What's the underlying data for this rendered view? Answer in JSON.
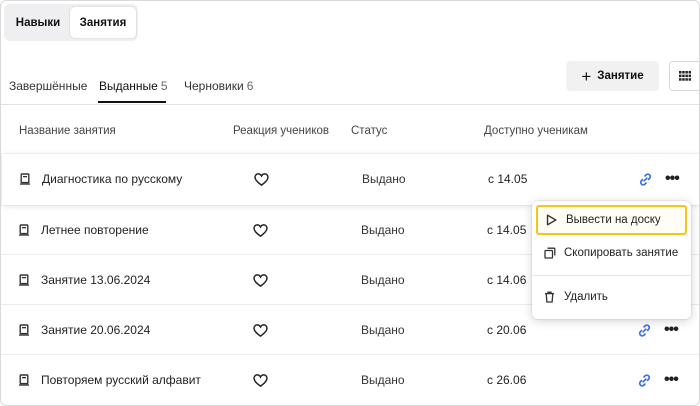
{
  "top_switch": {
    "items": [
      "Навыки",
      "Занятия"
    ],
    "active": "Занятия"
  },
  "tabs": [
    {
      "label": "Завершённые",
      "count": ""
    },
    {
      "label": "Выданные",
      "count": "5"
    },
    {
      "label": "Черновики",
      "count": "6"
    }
  ],
  "actions": {
    "add_label": "Занятие",
    "add_icon": "plus-icon",
    "view_icon": "grid-view-icon"
  },
  "table": {
    "headers": {
      "name": "Название занятия",
      "reaction": "Реакция учеников",
      "status": "Статус",
      "available": "Доступно ученикам"
    },
    "rows": [
      {
        "name": "Диагностика по русскому",
        "status": "Выдано",
        "date": "с 14.05"
      },
      {
        "name": "Летнее повторение",
        "status": "Выдано",
        "date": "с 14.05"
      },
      {
        "name": "Занятие 13.06.2024",
        "status": "Выдано",
        "date": "с 14.06"
      },
      {
        "name": "Занятие 20.06.2024",
        "status": "Выдано",
        "date": "с 20.06"
      },
      {
        "name": "Повторяем русский алфавит",
        "status": "Выдано",
        "date": "с 26.06"
      }
    ]
  },
  "context_menu": {
    "items": [
      {
        "label": "Вывести на доску",
        "icon": "play-icon"
      },
      {
        "label": "Скопировать занятие",
        "icon": "copy-icon"
      },
      {
        "label": "Удалить",
        "icon": "trash-icon"
      }
    ]
  },
  "colors": {
    "link": "#3a6ee8",
    "highlight": "#f5c518",
    "tab_underline": "#111111"
  }
}
